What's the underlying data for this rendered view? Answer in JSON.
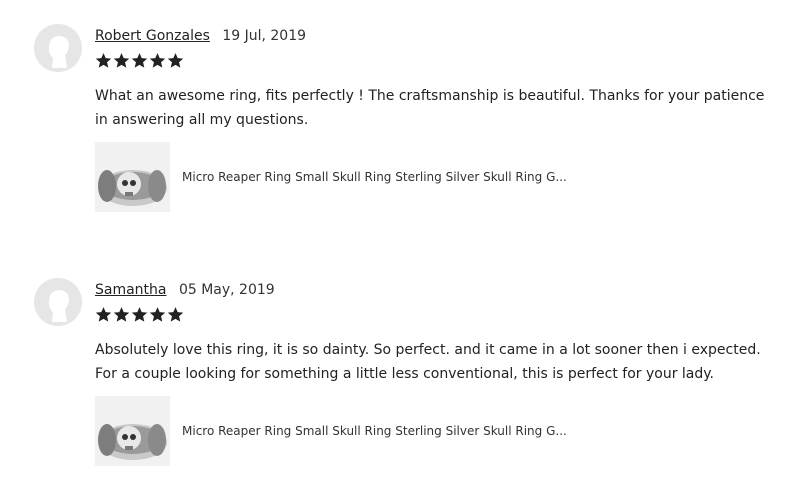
{
  "reviews": [
    {
      "reviewer": "Robert Gonzales",
      "date": "19 Jul, 2019",
      "rating": 5,
      "text": "What an awesome ring, fits perfectly ! The craftsmanship is beautiful. Thanks for your patience in answering all my questions.",
      "product_title": "Micro Reaper Ring Small Skull Ring Sterling Silver Skull Ring G..."
    },
    {
      "reviewer": "Samantha",
      "date": "05 May, 2019",
      "rating": 5,
      "text": "Absolutely love this ring, it is so dainty. So perfect. and it came in a lot sooner then i expected. For a couple looking for something a little less conventional, this is perfect for your lady.",
      "product_title": "Micro Reaper Ring Small Skull Ring Sterling Silver Skull Ring G..."
    }
  ],
  "colors": {
    "star": "#222222",
    "avatar_bg": "#e6e6e6",
    "avatar_fg": "#ffffff"
  },
  "icons": {
    "star": "star-icon",
    "avatar": "default-avatar-icon"
  }
}
